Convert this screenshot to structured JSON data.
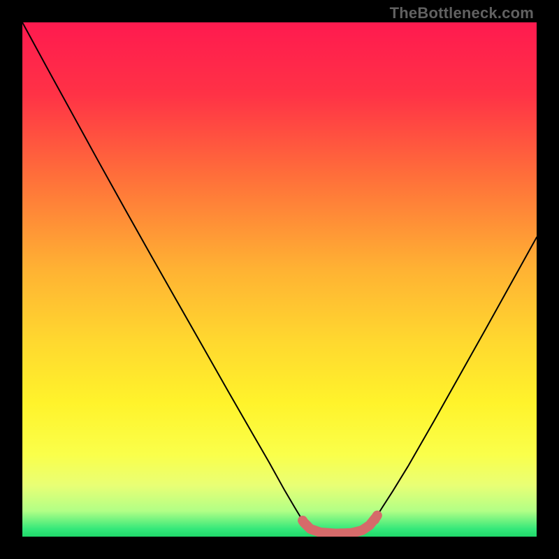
{
  "watermark": "TheBottleneck.com",
  "chart_data": {
    "type": "line",
    "title": "",
    "xlabel": "",
    "ylabel": "",
    "xlim": [
      0,
      1
    ],
    "ylim": [
      0,
      1
    ],
    "gradient_stops": [
      {
        "offset": 0.0,
        "color": "#ff1a4f"
      },
      {
        "offset": 0.14,
        "color": "#ff3246"
      },
      {
        "offset": 0.3,
        "color": "#ff6f3a"
      },
      {
        "offset": 0.48,
        "color": "#ffb233"
      },
      {
        "offset": 0.62,
        "color": "#ffd82f"
      },
      {
        "offset": 0.74,
        "color": "#fff32b"
      },
      {
        "offset": 0.84,
        "color": "#faff4a"
      },
      {
        "offset": 0.9,
        "color": "#e9ff75"
      },
      {
        "offset": 0.95,
        "color": "#b2ff86"
      },
      {
        "offset": 0.985,
        "color": "#35e87a"
      },
      {
        "offset": 1.0,
        "color": "#1fd86a"
      }
    ],
    "series": [
      {
        "name": "bottleneck-curve",
        "points": [
          {
            "x": 0.0,
            "y": 1.0
          },
          {
            "x": 0.05,
            "y": 0.908
          },
          {
            "x": 0.1,
            "y": 0.817
          },
          {
            "x": 0.15,
            "y": 0.726
          },
          {
            "x": 0.2,
            "y": 0.636
          },
          {
            "x": 0.25,
            "y": 0.547
          },
          {
            "x": 0.3,
            "y": 0.459
          },
          {
            "x": 0.35,
            "y": 0.371
          },
          {
            "x": 0.4,
            "y": 0.283
          },
          {
            "x": 0.45,
            "y": 0.196
          },
          {
            "x": 0.48,
            "y": 0.144
          },
          {
            "x": 0.51,
            "y": 0.09
          },
          {
            "x": 0.53,
            "y": 0.056
          },
          {
            "x": 0.547,
            "y": 0.028
          },
          {
            "x": 0.56,
            "y": 0.015
          },
          {
            "x": 0.58,
            "y": 0.008
          },
          {
            "x": 0.61,
            "y": 0.006
          },
          {
            "x": 0.64,
            "y": 0.007
          },
          {
            "x": 0.66,
            "y": 0.012
          },
          {
            "x": 0.675,
            "y": 0.022
          },
          {
            "x": 0.688,
            "y": 0.038
          },
          {
            "x": 0.7,
            "y": 0.057
          },
          {
            "x": 0.72,
            "y": 0.088
          },
          {
            "x": 0.75,
            "y": 0.137
          },
          {
            "x": 0.8,
            "y": 0.224
          },
          {
            "x": 0.85,
            "y": 0.313
          },
          {
            "x": 0.9,
            "y": 0.402
          },
          {
            "x": 0.95,
            "y": 0.492
          },
          {
            "x": 1.0,
            "y": 0.582
          }
        ]
      }
    ],
    "optimal_band": {
      "x_start": 0.545,
      "x_end": 0.69
    },
    "marker": {
      "x": 0.685,
      "y": 0.033,
      "radius_px": 7
    }
  }
}
